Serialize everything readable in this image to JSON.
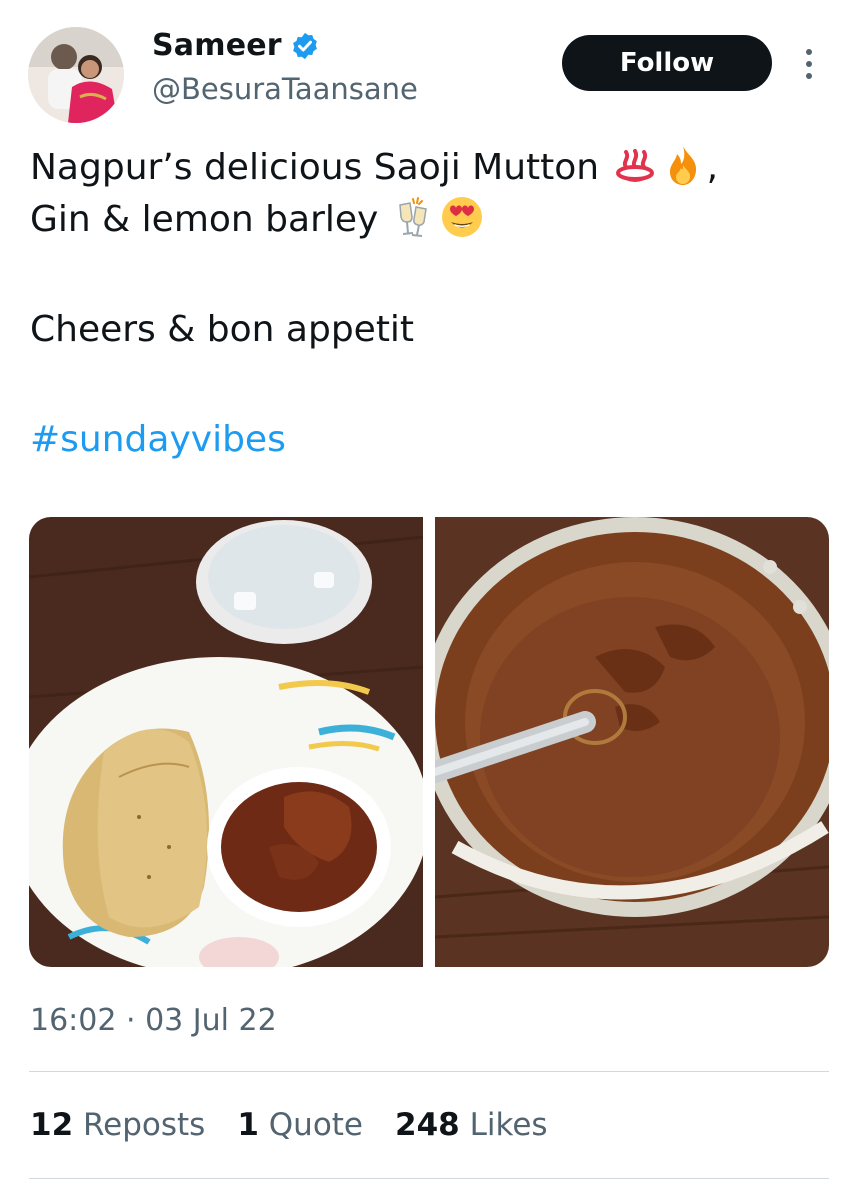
{
  "author": {
    "display_name": "Sameer",
    "handle": "@BesuraTaansane",
    "verified": true,
    "avatar_icon": "profile-photo"
  },
  "actions": {
    "follow_label": "Follow",
    "more_icon": "more-vertical-icon"
  },
  "tweet": {
    "line1_text": "Nagpur’s delicious Saoji Mutton ",
    "line1_trailing": ",",
    "line2_text": "Gin & lemon barley ",
    "line3_text": "Cheers & bon appetit",
    "hashtag": "#sundayvibes",
    "emojis": [
      "hot-springs-emoji",
      "fire-emoji",
      "clinking-glasses-emoji",
      "heart-eyes-emoji"
    ]
  },
  "media": [
    {
      "name": "photo-plate-rotis-curry"
    },
    {
      "name": "photo-pot-of-mutton-curry"
    }
  ],
  "timestamp": "16:02 · 03 Jul 22",
  "stats": {
    "reposts_count": "12",
    "reposts_label": "Reposts",
    "quotes_count": "1",
    "quotes_label": "Quote",
    "likes_count": "248",
    "likes_label": "Likes"
  },
  "colors": {
    "link": "#1d9bf0",
    "secondary_text": "#536471",
    "follow_bg": "#0f1419",
    "verified": "#1d9bf0"
  }
}
